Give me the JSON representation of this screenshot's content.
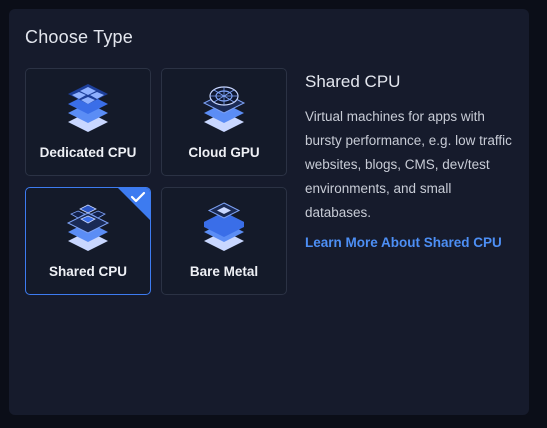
{
  "header": {
    "title": "Choose Type"
  },
  "types": [
    {
      "label": "Dedicated CPU",
      "icon": "dedicated-cpu-icon",
      "selected": false
    },
    {
      "label": "Cloud GPU",
      "icon": "cloud-gpu-icon",
      "selected": false
    },
    {
      "label": "Shared CPU",
      "icon": "shared-cpu-icon",
      "selected": true
    },
    {
      "label": "Bare Metal",
      "icon": "bare-metal-icon",
      "selected": false
    }
  ],
  "details": {
    "title": "Shared CPU",
    "description": "Virtual machines for apps with bursty performance, e.g. low traffic websites, blogs, CMS, dev/test environments, and small databases.",
    "link_text": "Learn More About Shared CPU"
  },
  "colors": {
    "accent": "#3d7bf0",
    "link": "#4d8ff5",
    "panel": "#161b2c",
    "background": "#0b0e18"
  }
}
